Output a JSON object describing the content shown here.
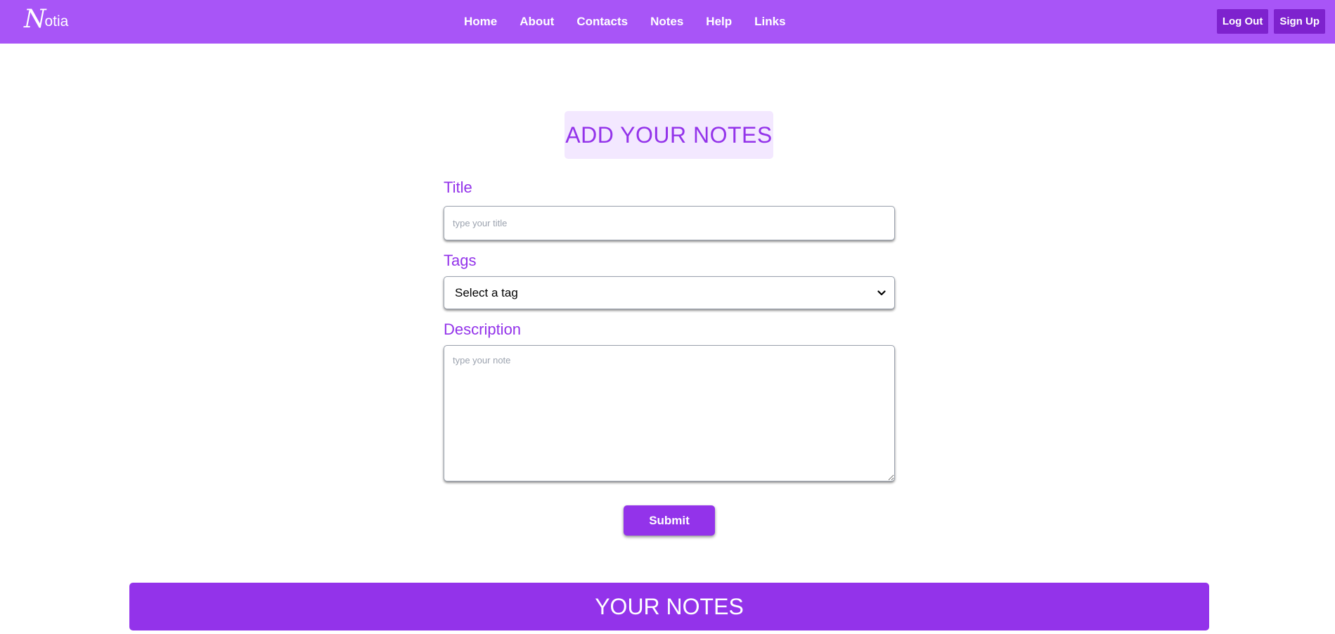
{
  "navbar": {
    "logo": {
      "initial": "N",
      "rest": "otia"
    },
    "links": [
      "Home",
      "About",
      "Contacts",
      "Notes",
      "Help",
      "Links"
    ],
    "logout_label": "Log Out",
    "signup_label": "Sign Up"
  },
  "form": {
    "heading": "ADD YOUR NOTES",
    "title_label": "Title",
    "title_placeholder": "type your title",
    "tags_label": "Tags",
    "tags_selected": "Select a tag",
    "description_label": "Description",
    "description_placeholder": "type your note",
    "submit_label": "Submit"
  },
  "notes_section": {
    "heading": "YOUR NOTES"
  },
  "colors": {
    "navbar": "#a855f7",
    "accent": "#9333ea",
    "auth_button": "#7e22ce",
    "heading_bg": "#f3e8ff"
  }
}
